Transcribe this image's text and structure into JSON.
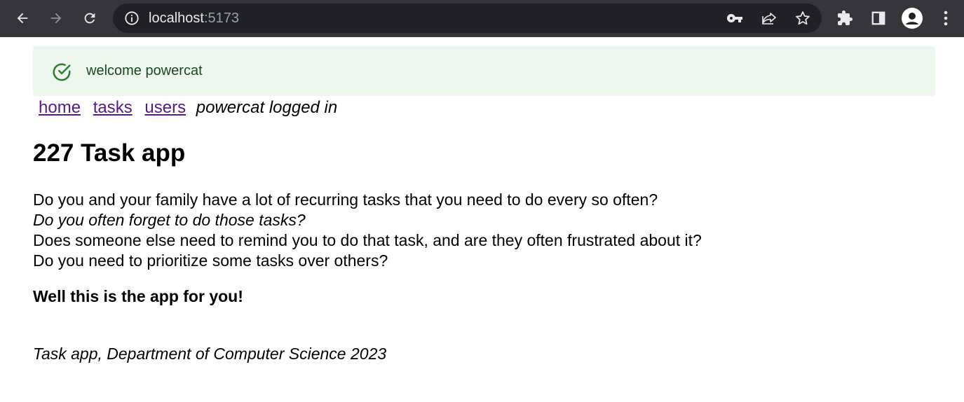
{
  "browser": {
    "url_host": "localhost",
    "url_port": ":5173"
  },
  "notification": {
    "message": "welcome powercat",
    "color": "#edf7ed"
  },
  "nav": {
    "links": [
      "home",
      "tasks",
      "users"
    ],
    "status": "powercat logged in"
  },
  "main": {
    "title": "227 Task app",
    "paragraphs": [
      "Do you and your family have a lot of recurring tasks that you need to do every so often?",
      "Do you often forget to do those tasks?",
      "Does someone else need to remind you to do that task, and are they often frustrated about it?",
      "Do you need to prioritize some tasks over others?"
    ],
    "cta": "Well this is the app for you!"
  },
  "footer": {
    "text": "Task app, Department of Computer Science 2023"
  }
}
